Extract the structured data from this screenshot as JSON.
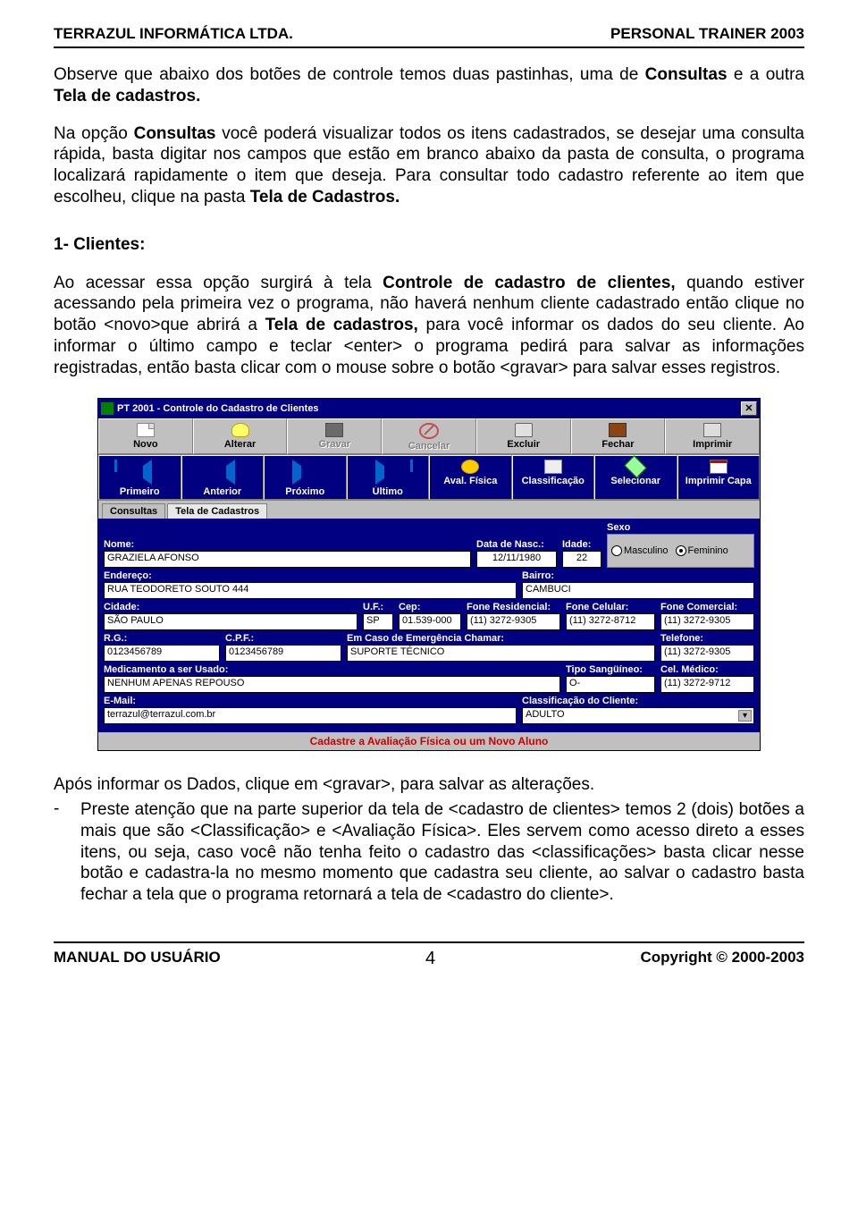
{
  "header": {
    "left": "TERRAZUL INFORMÁTICA LTDA.",
    "right": "PERSONAL TRAINER 2003"
  },
  "body": {
    "p1a": "Observe que abaixo dos botões de controle temos duas pastinhas, uma de ",
    "p1b": "Consultas",
    "p1c": "  e a outra ",
    "p1d": "Tela de cadastros.",
    "p2a": "Na opção  ",
    "p2b": "Consultas",
    "p2c": "  você poderá visualizar todos os itens cadastrados, se desejar uma consulta rápida, basta digitar nos campos que estão em branco abaixo da pasta de consulta,  o programa localizará rapidamente o item que deseja. Para consultar todo cadastro referente ao item que escolheu, clique na pasta  ",
    "p2d": "Tela de Cadastros.",
    "h1": "1-   Clientes:",
    "p3a": "Ao acessar essa opção surgirá à tela ",
    "p3b": "Controle de cadastro de clientes, ",
    "p3c": "quando estiver acessando pela primeira vez o programa, não haverá nenhum cliente cadastrado então clique no botão <novo>que abrirá a ",
    "p3d": "Tela de cadastros, ",
    "p3e": "para você informar os dados do seu cliente. Ao informar o último campo e teclar <enter> o programa pedirá para salvar as informações registradas, então basta clicar com o mouse sobre o botão <gravar> para salvar esses registros.",
    "p4": "Após informar os Dados, clique em <gravar>, para salvar as alterações.",
    "p5_bullet": "-",
    "p5": "Preste atenção que na parte superior da tela de <cadastro de clientes> temos 2 (dois) botões a mais que são <Classificação> e <Avaliação Física>. Eles servem como acesso direto a esses itens, ou seja, caso você não tenha feito o cadastro das <classificações> basta clicar nesse botão e cadastra-la no mesmo momento que cadastra seu cliente, ao salvar o cadastro basta fechar a tela que o programa retornará a tela de <cadastro do cliente>."
  },
  "window": {
    "title": "PT 2001 - Controle do Cadastro de Clientes",
    "close": "✕",
    "toolbar1": [
      "Novo",
      "Alterar",
      "Gravar",
      "Cancelar",
      "Excluir",
      "Fechar",
      "Imprimir"
    ],
    "toolbar2": [
      "Primeiro",
      "Anterior",
      "Próximo",
      "Último",
      "Aval. Física",
      "Classificação",
      "Selecionar",
      "Imprimir Capa"
    ],
    "tabs": {
      "consultas": "Consultas",
      "cadastros": "Tela de Cadastros"
    },
    "labels": {
      "nome": "Nome:",
      "datanasc": "Data de Nasc.:",
      "idade": "Idade:",
      "sexo": "Sexo",
      "sexo_m": "Masculino",
      "sexo_f": "Feminino",
      "endereco": "Endereço:",
      "bairro": "Bairro:",
      "cidade": "Cidade:",
      "uf": "U.F.:",
      "cep": "Cep:",
      "foneres": "Fone Residencial:",
      "fonecel": "Fone Celular:",
      "fonecom": "Fone Comercial:",
      "rg": "R.G.:",
      "cpf": "C.P.F.:",
      "emerg": "Em Caso de Emergência Chamar:",
      "telefone": "Telefone:",
      "med": "Medicamento a ser Usado:",
      "tipos": "Tipo Sangüíneo:",
      "celmed": "Cel. Médico:",
      "email": "E-Mail:",
      "classif": "Classificação do Cliente:"
    },
    "values": {
      "nome": "GRAZIELA AFONSO",
      "datanasc": "12/11/1980",
      "idade": "22",
      "endereco": "RUA TEODORETO SOUTO 444",
      "bairro": "CAMBUCI",
      "cidade": "SÃO PAULO",
      "uf": "SP",
      "cep": "01.539-000",
      "foneres": "(11) 3272-9305",
      "fonecel": "(11) 3272-8712",
      "fonecom": "(11) 3272-9305",
      "rg": "0123456789",
      "cpf": "0123456789",
      "emerg": "SUPORTE TÉCNICO",
      "telefone": "(11) 3272-9305",
      "med": "NENHUM APENAS REPOUSO",
      "tipos": "O-",
      "celmed": "(11) 3272-9712",
      "email": "terrazul@terrazul.com.br",
      "classif": "ADULTO"
    },
    "status": "Cadastre a Avaliação Física ou um Novo Aluno"
  },
  "footer": {
    "left": "MANUAL DO USUÁRIO",
    "page": "4",
    "right": "Copyright © 2000-2003"
  }
}
